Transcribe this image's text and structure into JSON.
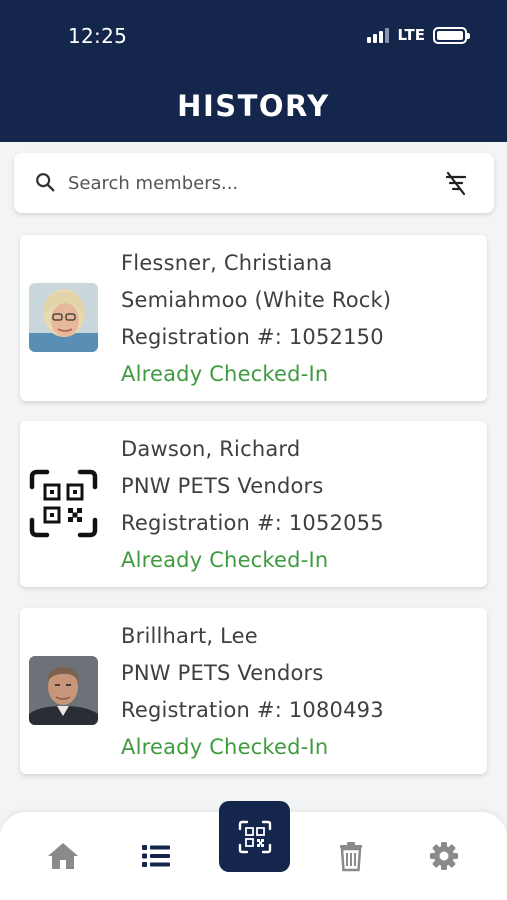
{
  "status_bar": {
    "time": "12:25",
    "network": "LTE"
  },
  "header": {
    "title": "HISTORY"
  },
  "search": {
    "placeholder": "Search members..."
  },
  "members": [
    {
      "name": "Flessner, Christiana",
      "club": "Semiahmoo (White Rock)",
      "registration": "Registration #: 1052150",
      "status": "Already Checked-In",
      "avatar": "photo-avatar"
    },
    {
      "name": "Dawson, Richard",
      "club": "PNW PETS Vendors",
      "registration": "Registration #: 1052055",
      "status": "Already Checked-In",
      "avatar": "qr-code-icon"
    },
    {
      "name": "Brillhart, Lee",
      "club": "PNW PETS Vendors",
      "registration": "Registration #: 1080493",
      "status": "Already Checked-In",
      "avatar": "photo-avatar"
    }
  ],
  "bottom_nav": {
    "items": [
      {
        "icon": "home-icon"
      },
      {
        "icon": "list-icon",
        "active": true
      },
      {
        "icon": "qr-scan-icon"
      },
      {
        "icon": "trash-icon"
      },
      {
        "icon": "gear-icon"
      }
    ]
  },
  "colors": {
    "header_bg": "#14264c",
    "status_green": "#3f9b3f",
    "inactive_icon": "#8a8a8a",
    "active_icon": "#14264c"
  }
}
